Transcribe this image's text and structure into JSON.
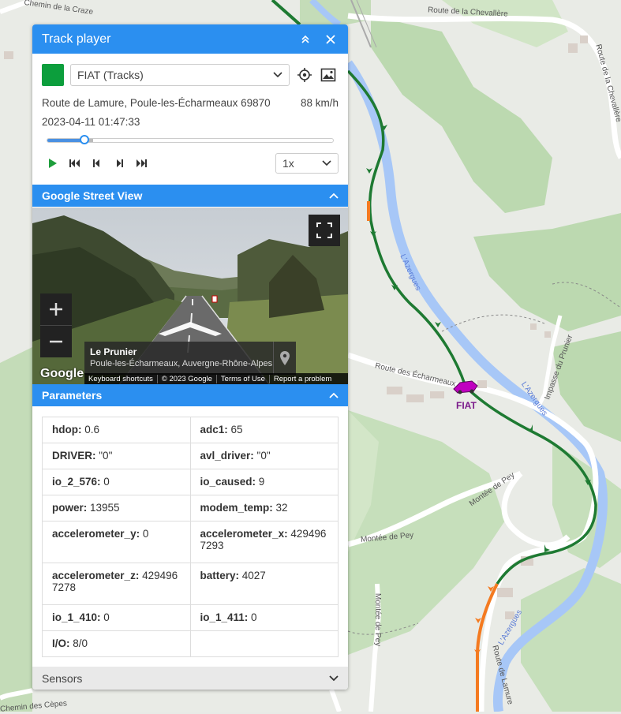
{
  "map": {
    "labels": {
      "chemin_craze": "Chemin de la Craze",
      "route_chevallere": "Route de la Chevallère",
      "route_chevallere_2": "Route de la Chevallère",
      "azergues_1": "L'Azergues",
      "azergues_2": "L'Azergues",
      "azergues_3": "L'Azergues",
      "impasse_prunier": "Impasse du Prunier",
      "route_echarmeaux": "Route des Écharmeaux",
      "montee_pey_1": "Montée de Pey",
      "montee_pey_2": "Montée de Pey",
      "montee_pey_3": "Montée de Pey",
      "route_lamure": "Route de Lamure",
      "chemin_cepes": "Chemin des Cèpes"
    },
    "vehicle_label": "FIAT",
    "colors": {
      "track_green": "#1e7a32",
      "track_orange": "#f47a20",
      "vehicle": "#c000c0",
      "river": "#a7c7f7"
    }
  },
  "panel": {
    "title": "Track player",
    "device": {
      "label": "FIAT (Tracks)",
      "color": "#0c9e3c"
    },
    "address": "Route de Lamure, Poule-les-Écharmeaux 69870",
    "speed": "88 km/h",
    "datetime": "2023-04-11 01:47:33",
    "progress": 0.13,
    "buffered": 0.16,
    "playback_speed": "1x",
    "icons": {
      "collapse": "double-chevron-up-icon",
      "close": "close-icon",
      "locate": "crosshair-icon",
      "image": "image-icon",
      "play": "play-icon"
    }
  },
  "street_view": {
    "title": "Google Street View",
    "place": "Le Prunier",
    "region": "Poule-les-Écharmeaux, Auvergne-Rhône-Alpes",
    "google": "Google",
    "footer": [
      "Keyboard shortcuts",
      "© 2023 Google",
      "Terms of Use",
      "Report a problem"
    ]
  },
  "parameters": {
    "title": "Parameters",
    "rows": [
      [
        {
          "k": "hdop:",
          "v": " 0.6"
        },
        {
          "k": "adc1:",
          "v": " 65"
        }
      ],
      [
        {
          "k": "DRIVER:",
          "v": " \"0\""
        },
        {
          "k": "avl_driver:",
          "v": " \"0\""
        }
      ],
      [
        {
          "k": "io_2_576:",
          "v": " 0"
        },
        {
          "k": "io_caused:",
          "v": " 9"
        }
      ],
      [
        {
          "k": "power:",
          "v": " 13955"
        },
        {
          "k": "modem_temp:",
          "v": " 32"
        }
      ],
      [
        {
          "k": "accelerometer_y:",
          "v": " 0"
        },
        {
          "k": "accelerometer_x:",
          "v": " 4294967293"
        }
      ],
      [
        {
          "k": "accelerometer_z:",
          "v": " 4294967278"
        },
        {
          "k": "battery:",
          "v": " 4027"
        }
      ],
      [
        {
          "k": "io_1_410:",
          "v": " 0"
        },
        {
          "k": "io_1_411:",
          "v": " 0"
        }
      ],
      [
        {
          "k": "I/O:",
          "v": " 8/0"
        },
        {
          "k": "",
          "v": ""
        }
      ]
    ]
  },
  "sensors": {
    "title": "Sensors"
  }
}
